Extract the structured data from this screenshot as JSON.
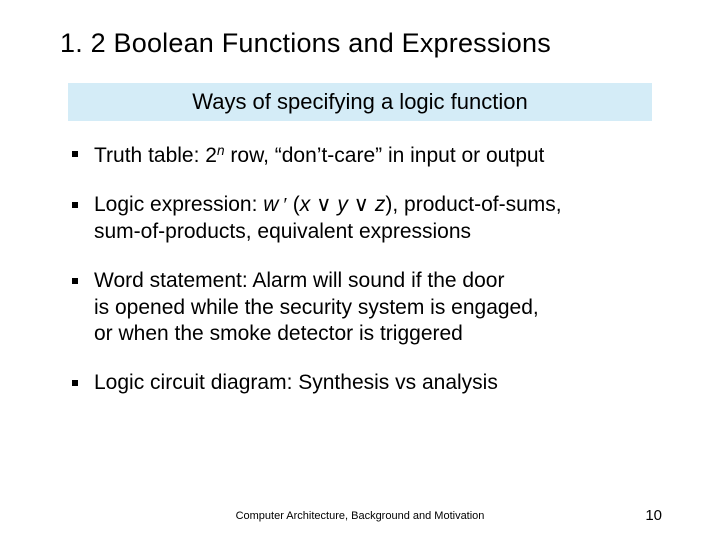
{
  "title": "1. 2  Boolean Functions and Expressions",
  "banner": "Ways of specifying a logic function",
  "bullets": {
    "b1_pre": "Truth table: 2",
    "b1_sup": "n",
    "b1_post": " row, “don’t-care” in input or output",
    "b2_pre": "Logic expression: ",
    "b2_w": "w",
    "b2_prime": " ′ ",
    "b2_paren_open": "(",
    "b2_x": "x",
    "b2_or1": " ∨ ",
    "b2_y": "y",
    "b2_or2": " ∨ ",
    "b2_z": "z",
    "b2_paren_close": "), product-of-sums,",
    "b2_line2": "sum-of-products, equivalent expressions",
    "b3_line1": "Word statement: Alarm will sound if the door",
    "b3_line2": "is opened while the security system is engaged,",
    "b3_line3": "or when the smoke detector is triggered",
    "b4": "Logic circuit diagram: Synthesis vs analysis"
  },
  "footer": "Computer Architecture, Background and Motivation",
  "page_number": "10"
}
